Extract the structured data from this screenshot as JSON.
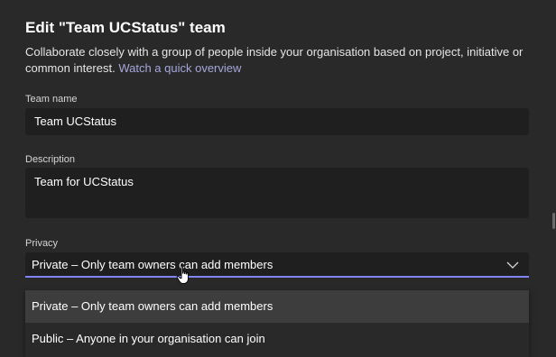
{
  "dialog": {
    "title": "Edit \"Team UCStatus\" team",
    "subtitle": "Collaborate closely with a group of people inside your organisation based on project, initiative or common interest.",
    "overview_link": "Watch a quick overview"
  },
  "fields": {
    "team_name_label": "Team name",
    "team_name_value": "Team UCStatus",
    "description_label": "Description",
    "description_value": "Team for UCStatus",
    "privacy_label": "Privacy",
    "privacy_value": "Private – Only team owners can add members"
  },
  "privacy_options": [
    {
      "label": "Private – Only team owners can add members",
      "highlighted": true
    },
    {
      "label": "Public – Anyone in your organisation can join",
      "highlighted": false
    }
  ],
  "colors": {
    "background": "#292929",
    "input_background": "#1f1f1f",
    "accent": "#7f85f5",
    "link": "#a6a7dc"
  },
  "icons": {
    "chevron": "chevron-down-icon",
    "cursor": "hand-pointer-cursor-icon"
  }
}
